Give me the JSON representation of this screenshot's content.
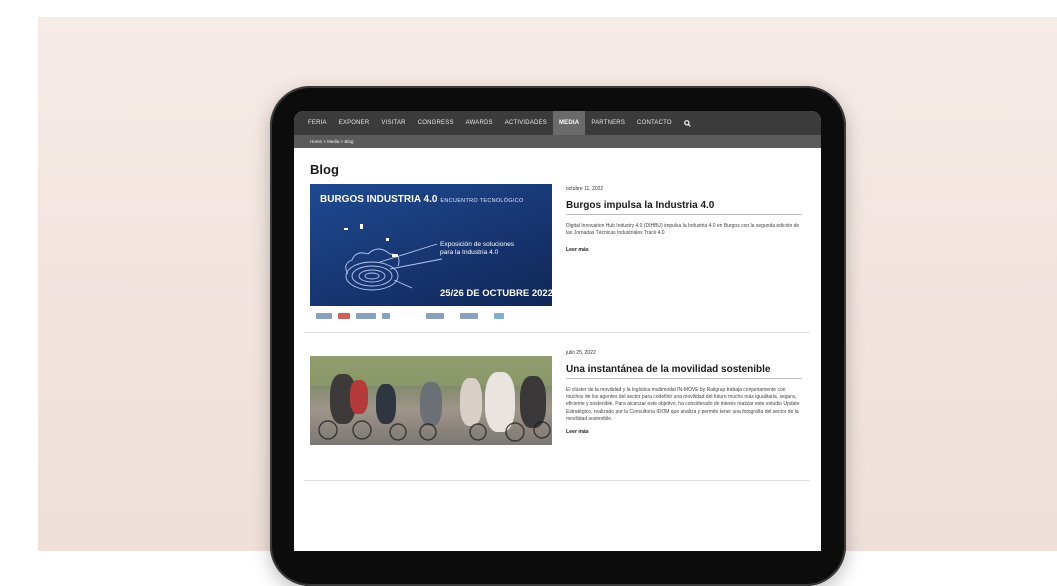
{
  "nav": {
    "items": [
      "FERIA",
      "EXPONER",
      "VISITAR",
      "CONGRESS",
      "AWARDS",
      "ACTIVIDADES",
      "MEDIA",
      "PARTNERS",
      "CONTACTO"
    ],
    "active": "MEDIA",
    "search_icon": "search-icon"
  },
  "breadcrumb": "Home > Media > Blog",
  "page": {
    "title": "Blog"
  },
  "posts": [
    {
      "date": "octubre 11, 2022",
      "title": "Burgos impulsa la Industria 4.0",
      "excerpt": "Digital Innovation Hub Industry 4.0 (DIHBU) impulsa la Industria 4.0 en Burgos con la segunda edición de las Jornadas Técnicas Industriales Track 4.0",
      "read_more": "Leer más",
      "image": {
        "title": "BURGOS INDUSTRIA 4.0",
        "subtitle": "ENCUENTRO TECNOLÓGICO",
        "expo_line1": "Exposición de soluciones",
        "expo_line2": "para la Industria 4.0",
        "dates": "25/26 DE OCTUBRE 2022"
      }
    },
    {
      "date": "julio 25, 2022",
      "title": "Una instantánea de la movilidad sostenible",
      "excerpt": "El clúster de la movilidad y la logística multimodal IN-MOVE by Railgrup trabaja conjuntamente con muchos de los agentes del sector para codefinir una movilidad del futuro mucho más igualitaria, segura, eficiente y sostenible. Para alcanzar este objetivo, ha considerado de interés realizar este estudio Update Estratégico, realizado por la Consultoría IDOM que analiza y permite tener una fotografía del sector de la movilidad sostenible.",
      "read_more": "Leer más"
    }
  ],
  "colors": {
    "nav_bg": "#3b3b3b",
    "nav_active": "#6a6a6a",
    "breadcrumb_bg": "#5b5b5b",
    "banner_blue": "#1f4a91"
  }
}
